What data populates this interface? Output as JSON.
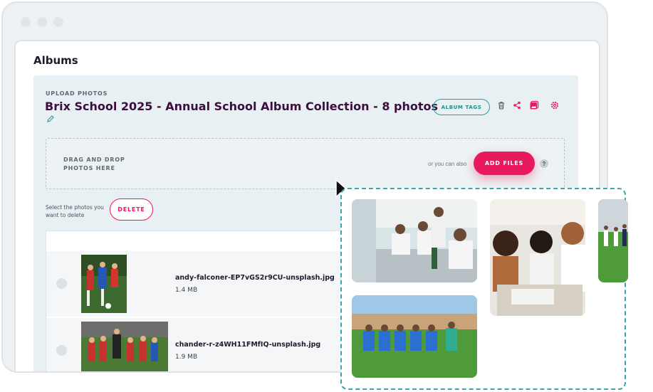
{
  "page": {
    "title": "Albums"
  },
  "upload": {
    "section_label": "UPLOAD PHOTOS",
    "album_title": "Brix School 2025 - Annual School Album Collection - 8 photos",
    "album_tags_label": "ALBUM TAGS",
    "icons": [
      "trash-icon",
      "share-icon",
      "image-icon",
      "gear-icon"
    ]
  },
  "dropzone": {
    "instruction": "DRAG AND DROP\nPHOTOS HERE",
    "or_text": "or you can also",
    "add_files_label": "ADD FILES",
    "help_label": "?"
  },
  "selection": {
    "hint": "Select the photos you want to delete",
    "delete_label": "DELETE"
  },
  "files": [
    {
      "name": "andy-falconer-EP7vGS2r9CU-unsplash.jpg",
      "size": "1.4 MB"
    },
    {
      "name": "chander-r-z4WH11FMfIQ-unsplash.jpg",
      "size": "1.9 MB"
    }
  ],
  "colors": {
    "accent_pink": "#e8195d",
    "accent_teal": "#2aa39c",
    "title_purple": "#3a0f3e",
    "card_bg": "#e9f0f3"
  }
}
